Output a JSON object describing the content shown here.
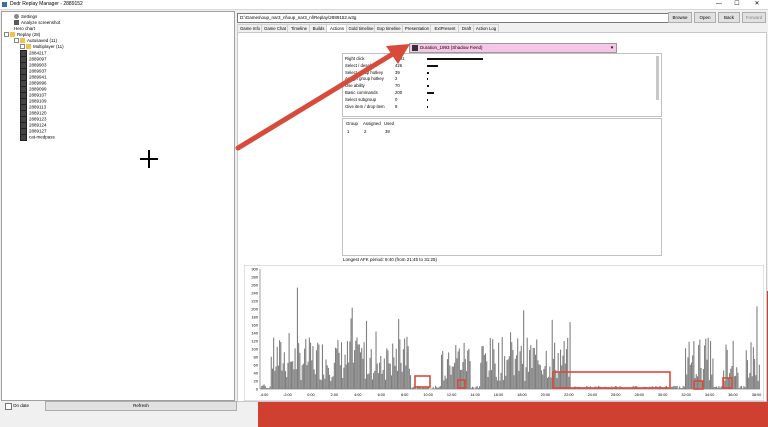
{
  "window": {
    "title": "Dedr Replay Manager - 2889152",
    "minimize": "—",
    "maximize": "☐",
    "close": "✕"
  },
  "tree": {
    "items": [
      {
        "label": "Settings",
        "icon": "gear-icon",
        "level": 1
      },
      {
        "label": "Analyze screenshot",
        "icon": "camera-icon",
        "level": 1
      },
      {
        "label": "Hero chart",
        "icon": "chart-icon",
        "level": 1
      },
      {
        "label": "Replay (28)",
        "icon": "folder-icon",
        "level": 0
      },
      {
        "label": "Autosaved (11)",
        "icon": "folder-icon",
        "level": 1
      },
      {
        "label": "Multiplayer (11)",
        "icon": "folder-icon",
        "level": 2
      },
      {
        "label": "2884217",
        "icon": "replay-icon",
        "level": 1
      },
      {
        "label": "2889097",
        "icon": "replay-icon",
        "level": 1
      },
      {
        "label": "2889903",
        "icon": "replay-icon",
        "level": 1
      },
      {
        "label": "2889937",
        "icon": "replay-icon",
        "level": 1
      },
      {
        "label": "2889941",
        "icon": "replay-icon",
        "level": 1
      },
      {
        "label": "2889996",
        "icon": "replay-icon",
        "level": 1
      },
      {
        "label": "2889099",
        "icon": "replay-icon",
        "level": 1
      },
      {
        "label": "2889107",
        "icon": "replay-icon",
        "level": 1
      },
      {
        "label": "2889109",
        "icon": "replay-icon",
        "level": 1
      },
      {
        "label": "2889113",
        "icon": "replay-icon",
        "level": 1
      },
      {
        "label": "2889120",
        "icon": "replay-icon",
        "level": 1
      },
      {
        "label": "2889123",
        "icon": "replay-icon",
        "level": 1
      },
      {
        "label": "2889124",
        "icon": "replay-icon",
        "level": 1
      },
      {
        "label": "2889127",
        "icon": "replay-icon",
        "level": 1
      },
      {
        "label": "cat-medpass",
        "icon": "replay-icon",
        "level": 1
      }
    ]
  },
  "footer": {
    "checkbox_label": "On date",
    "refresh_label": "Refresh"
  },
  "toolbar": {
    "path": "D:\\Games\\oup_nar3_nl\\oup_nar3_nl\\Replay\\2889152.w3g",
    "browse_label": "Browse",
    "open_label": "Open",
    "back_label": "Back",
    "forward_label": "Forward"
  },
  "tabs": [
    "Game Info",
    "Game Chat",
    "Timeline",
    "Builds",
    "Actions",
    "Gold timeline",
    "Exp timeline",
    "Presentation",
    "ExtPresent",
    "Draft",
    "Action Log"
  ],
  "active_tab": "Actions",
  "player": {
    "name": "Duration_1993 (Shadow Fiend)",
    "highlight": "#f6c6e6"
  },
  "stats": [
    {
      "label": "Right click",
      "value": "2101",
      "bar": 1.0
    },
    {
      "label": "Select / deselect",
      "value": "426",
      "bar": 0.2
    },
    {
      "label": "Select group hotkey",
      "value": "39",
      "bar": 0.03
    },
    {
      "label": "Assign group hotkey",
      "value": "2",
      "bar": 0.0
    },
    {
      "label": "Use ability",
      "value": "70",
      "bar": 0.04
    },
    {
      "label": "Basic commands",
      "value": "200",
      "bar": 0.13
    },
    {
      "label": "Select subgroup",
      "value": "0",
      "bar": 0.0
    },
    {
      "label": "Give item / drop item",
      "value": "8",
      "bar": 0.0
    }
  ],
  "group_table": {
    "headers": [
      "Group",
      "Assigned",
      "Used"
    ],
    "rows": [
      [
        "1",
        "2",
        "39"
      ]
    ]
  },
  "afk_text": "Longest AFK period: 9:40 (from 21:45 to 31:25)",
  "chart_data": {
    "type": "bar",
    "ylim": [
      0,
      300
    ],
    "yticks": [
      "300",
      "280",
      "260",
      "240",
      "220",
      "200",
      "180",
      "160",
      "140",
      "120",
      "100",
      "80",
      "60",
      "40",
      "20",
      "0"
    ],
    "xticks": [
      "-4:00",
      "-2:00",
      "0:00",
      "2:00",
      "4:00",
      "6:00",
      "8:00",
      "10:00",
      "12:00",
      "14:00",
      "16:00",
      "18:00",
      "20:00",
      "22:00",
      "24:00",
      "26:00",
      "28:00",
      "30:00",
      "32:00",
      "34:00",
      "36:00",
      "38:00"
    ],
    "bar_color": "#7f7f7f",
    "highlight_color": "#d84a3a"
  },
  "colors": {
    "arrow": "#d84a3a"
  }
}
